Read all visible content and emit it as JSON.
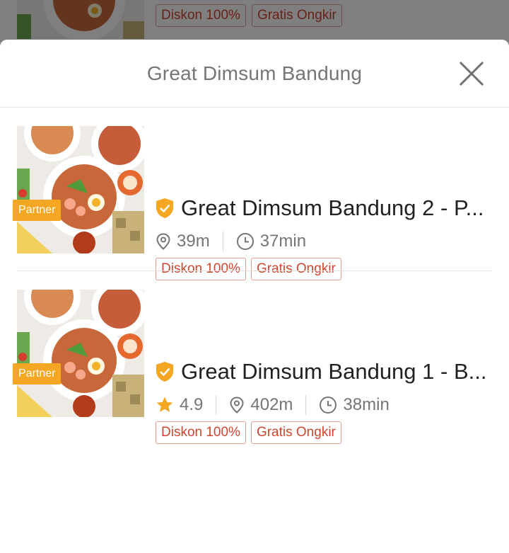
{
  "background_card": {
    "tags": [
      "Diskon 100%",
      "Gratis Ongkir"
    ]
  },
  "sheet": {
    "title": "Great Dimsum Bandung"
  },
  "merchants": [
    {
      "badge": "Partner",
      "name": "Great Dimsum Bandung 2 - P...",
      "distance": "39m",
      "time": "37min",
      "tags": [
        "Diskon 100%",
        "Gratis Ongkir"
      ]
    },
    {
      "badge": "Partner",
      "name": "Great Dimsum Bandung 1 - B...",
      "rating": "4.9",
      "distance": "402m",
      "time": "38min",
      "tags": [
        "Diskon 100%",
        "Gratis Ongkir"
      ]
    }
  ],
  "colors": {
    "brand_orange": "#f5a623",
    "tag_red": "#d0452e",
    "tag_border": "#e0a090",
    "star": "#f5a623"
  },
  "icons": {
    "close": "close-icon",
    "verified": "verified-shield-icon",
    "location": "location-pin-icon",
    "clock": "clock-icon",
    "star": "star-icon"
  }
}
